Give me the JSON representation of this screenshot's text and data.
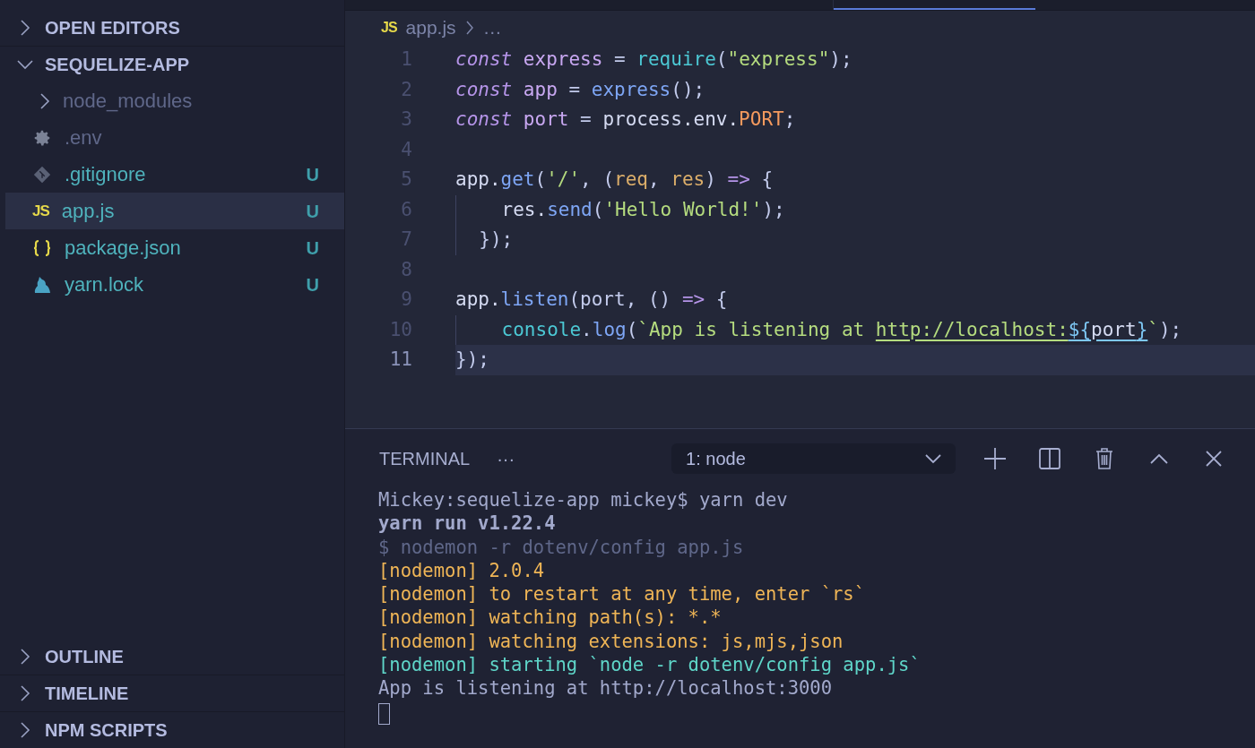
{
  "sidebar": {
    "sections": [
      {
        "title": "OPEN EDITORS",
        "expanded": false
      },
      {
        "title": "SEQUELIZE-APP",
        "expanded": true,
        "items": [
          {
            "kind": "folder",
            "name": "node_modules",
            "expanded": false,
            "selected": false
          },
          {
            "kind": "settings",
            "name": ".env",
            "selected": false
          },
          {
            "kind": "git",
            "name": ".gitignore",
            "status": "U",
            "selected": false
          },
          {
            "kind": "js",
            "icon_text": "JS",
            "name": "app.js",
            "status": "U",
            "selected": true
          },
          {
            "kind": "json",
            "name": "package.json",
            "status": "U",
            "selected": false
          },
          {
            "kind": "yarn",
            "name": "yarn.lock",
            "status": "U",
            "selected": false
          }
        ]
      }
    ],
    "bottom_sections": [
      {
        "title": "OUTLINE",
        "expanded": false
      },
      {
        "title": "TIMELINE",
        "expanded": false
      },
      {
        "title": "NPM SCRIPTS",
        "expanded": false
      }
    ]
  },
  "editor": {
    "breadcrumb": {
      "icon_text": "JS",
      "file": "app.js",
      "rest": "…"
    },
    "lines": [
      {
        "number": "1",
        "current": false,
        "tokens": [
          {
            "t": "const",
            "kind": "keyword"
          },
          {
            "t": " express",
            "kind": "variable"
          },
          {
            "t": " = ",
            "kind": "punct"
          },
          {
            "t": "require",
            "kind": "builtin"
          },
          {
            "t": "(",
            "kind": "punct"
          },
          {
            "t": "\"express\"",
            "kind": "string"
          },
          {
            "t": ");",
            "kind": "punct"
          }
        ]
      },
      {
        "number": "2",
        "current": false,
        "tokens": [
          {
            "t": "const",
            "kind": "keyword"
          },
          {
            "t": " app",
            "kind": "variable"
          },
          {
            "t": " = ",
            "kind": "punct"
          },
          {
            "t": "express",
            "kind": "function"
          },
          {
            "t": "();",
            "kind": "punct"
          }
        ]
      },
      {
        "number": "3",
        "current": false,
        "tokens": [
          {
            "t": "const",
            "kind": "keyword"
          },
          {
            "t": " port",
            "kind": "variable"
          },
          {
            "t": " = ",
            "kind": "punct"
          },
          {
            "t": "process.env.",
            "kind": "plain"
          },
          {
            "t": "PORT",
            "kind": "constant"
          },
          {
            "t": ";",
            "kind": "punct"
          }
        ]
      },
      {
        "number": "4",
        "current": false
      },
      {
        "number": "5",
        "current": false,
        "tokens": [
          {
            "t": "app.",
            "kind": "plain"
          },
          {
            "t": "get",
            "kind": "function"
          },
          {
            "t": "(",
            "kind": "punct"
          },
          {
            "t": "'/'",
            "kind": "string"
          },
          {
            "t": ", (",
            "kind": "punct"
          },
          {
            "t": "req",
            "kind": "param"
          },
          {
            "t": ", ",
            "kind": "punct"
          },
          {
            "t": "res",
            "kind": "param"
          },
          {
            "t": ") ",
            "kind": "punct"
          },
          {
            "t": "=>",
            "kind": "keyword-op"
          },
          {
            "t": " {",
            "kind": "punct"
          }
        ]
      },
      {
        "number": "6",
        "current": false,
        "tokens": [
          {
            "t": "    res.",
            "kind": "plain"
          },
          {
            "t": "send",
            "kind": "function"
          },
          {
            "t": "(",
            "kind": "punct"
          },
          {
            "t": "'Hello World!'",
            "kind": "string"
          },
          {
            "t": ");",
            "kind": "punct"
          }
        ]
      },
      {
        "number": "7",
        "current": false,
        "tokens": [
          {
            "t": "  });",
            "kind": "punct"
          }
        ]
      },
      {
        "number": "8",
        "current": false
      },
      {
        "number": "9",
        "current": false,
        "tokens": [
          {
            "t": "app.",
            "kind": "plain"
          },
          {
            "t": "listen",
            "kind": "function"
          },
          {
            "t": "(port, () ",
            "kind": "punct"
          },
          {
            "t": "=>",
            "kind": "keyword-op"
          },
          {
            "t": " {",
            "kind": "punct"
          }
        ]
      },
      {
        "number": "10",
        "current": false,
        "tokens": [
          {
            "t": "    console",
            "kind": "builtin"
          },
          {
            "t": ".",
            "kind": "punct"
          },
          {
            "t": "log",
            "kind": "function"
          },
          {
            "t": "(",
            "kind": "punct"
          },
          {
            "t": "`App is listening at ",
            "kind": "string"
          },
          {
            "t": "http://localhost:",
            "kind": "link"
          },
          {
            "t": "${",
            "kind": "link-brace"
          },
          {
            "t": "port",
            "kind": "link-var"
          },
          {
            "t": "}",
            "kind": "link-brace"
          },
          {
            "t": "`",
            "kind": "string"
          },
          {
            "t": ");",
            "kind": "punct"
          }
        ]
      },
      {
        "number": "11",
        "current": true,
        "tokens": [
          {
            "t": "});",
            "kind": "punct"
          }
        ]
      }
    ]
  },
  "terminal": {
    "tab": "TERMINAL",
    "more": "···",
    "dropdown": "1: node",
    "lines": [
      {
        "kind": "prompt",
        "text": "Mickey:sequelize-app mickey$ yarn dev"
      },
      {
        "kind": "bold",
        "text": "yarn run v1.22.4"
      },
      {
        "kind": "dim",
        "text": "$ nodemon -r dotenv/config app.js"
      },
      {
        "kind": "warn",
        "text": "[nodemon] 2.0.4"
      },
      {
        "kind": "warn",
        "text": "[nodemon] to restart at any time, enter `rs`"
      },
      {
        "kind": "warn",
        "text": "[nodemon] watching path(s): *.*"
      },
      {
        "kind": "warn",
        "text": "[nodemon] watching extensions: js,mjs,json"
      },
      {
        "kind": "info",
        "text": "[nodemon] starting `node -r dotenv/config app.js`"
      },
      {
        "kind": "prompt",
        "text": "App is listening at http://localhost:3000"
      }
    ]
  }
}
